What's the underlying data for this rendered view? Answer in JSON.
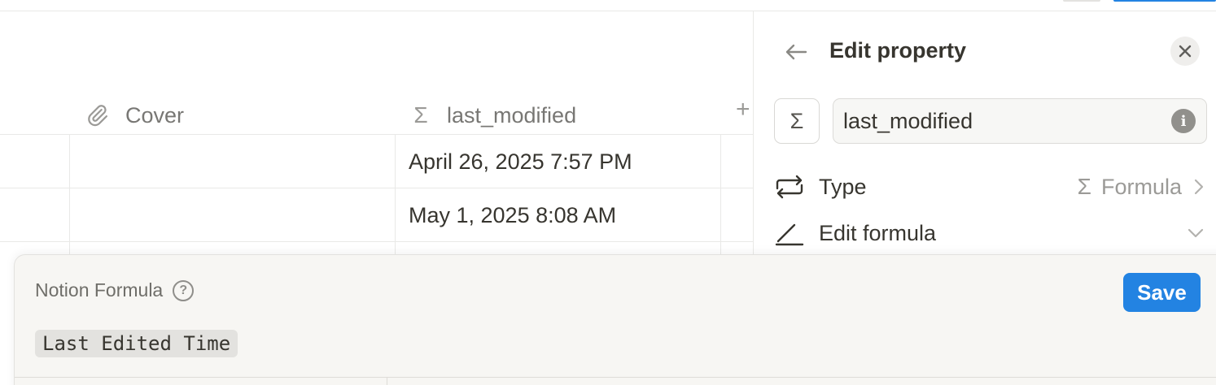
{
  "table": {
    "columns": [
      {
        "label": "Cover",
        "icon": "paperclip-icon"
      },
      {
        "label": "last_modified",
        "icon": "sigma-icon",
        "glyph": "Σ"
      }
    ],
    "add_column_glyph": "+",
    "rows": [
      {
        "last_modified": "April 26, 2025 7:57 PM"
      },
      {
        "last_modified": "May 1, 2025 8:08 AM"
      }
    ]
  },
  "panel": {
    "title": "Edit property",
    "property_icon": "Σ",
    "name_value": "last_modified",
    "type_label": "Type",
    "type_icon": "Σ",
    "type_value": "Formula",
    "edit_formula_label": "Edit formula"
  },
  "formula_editor": {
    "title": "Notion Formula",
    "help_glyph": "?",
    "save_label": "Save",
    "formula_text": "Last Edited Time"
  },
  "colors": {
    "accent": "#2383e2",
    "text": "#37352f",
    "muted": "#9b9a97"
  }
}
